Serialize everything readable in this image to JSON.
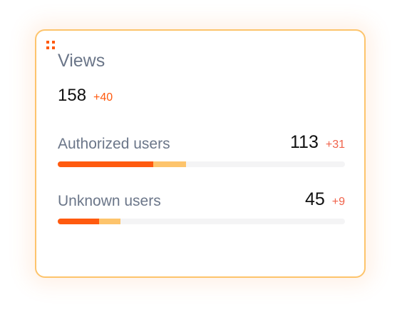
{
  "widget": {
    "title": "Views",
    "total": "158",
    "total_delta": "+40",
    "colors": {
      "accent": "#ff5a0f",
      "accent_light": "#fdc46c",
      "border": "#fdc46c",
      "track": "#f4f4f5",
      "label": "#6b7689",
      "delta": "#f0624a"
    },
    "icons": {
      "drag_handle": "drag-handle-icon"
    },
    "metrics": [
      {
        "label": "Authorized users",
        "value": "113",
        "delta": "+31",
        "bar": {
          "primary_fraction": 0.333,
          "secondary_fraction": 0.114
        }
      },
      {
        "label": "Unknown users",
        "value": "45",
        "delta": "+9",
        "bar": {
          "primary_fraction": 0.144,
          "secondary_fraction": 0.074
        }
      }
    ]
  }
}
